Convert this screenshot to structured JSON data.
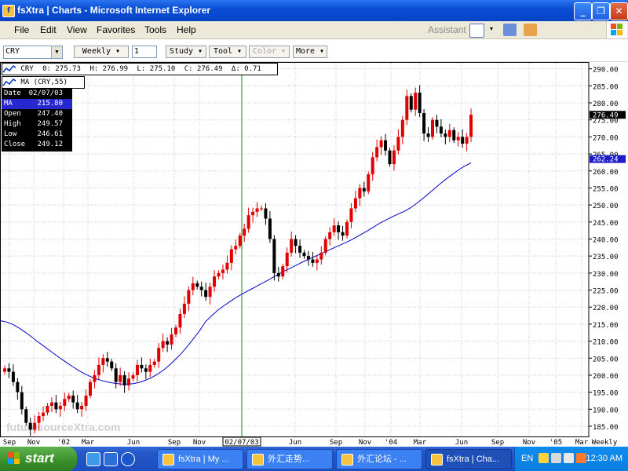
{
  "window": {
    "title": "fsXtra | Charts - Microsoft Internet Explorer",
    "app_icon": "fs-icon",
    "controls": [
      "minimize-icon",
      "maximize-icon",
      "close-icon"
    ]
  },
  "menubar": {
    "items": [
      "File",
      "Edit",
      "View",
      "Favorites",
      "Tools",
      "Help"
    ],
    "assistant": "Assistant"
  },
  "toolbar": {
    "symbol": "CRY",
    "period": "Weekly ▾",
    "count": "1",
    "study": "Study ▾",
    "tool": "Tool ▾",
    "color": "Color ▾",
    "more": "More ▾"
  },
  "chart_data": {
    "type": "candlestick",
    "symbol": "CRY",
    "ohlc_header": {
      "open": "0: 275.73",
      "high": "H: 276.99",
      "low": "L: 275.10",
      "close": "C: 276.49",
      "change": "Δ: 0.71"
    },
    "study_label": "MA (CRY,55)",
    "info_box": [
      {
        "label": "Date",
        "value": "02/07/03"
      },
      {
        "label": "MA",
        "value": "215.80"
      },
      {
        "label": "Open",
        "value": "247.40"
      },
      {
        "label": "High",
        "value": "249.57"
      },
      {
        "label": "Low",
        "value": "246.61"
      },
      {
        "label": "Close",
        "value": "249.12"
      }
    ],
    "y_ticks": [
      "290.00",
      "285.00",
      "280.00",
      "275.00",
      "270.00",
      "265.00",
      "260.00",
      "255.00",
      "250.00",
      "245.00",
      "240.00",
      "235.00",
      "230.00",
      "225.00",
      "220.00",
      "215.00",
      "210.00",
      "205.00",
      "200.00",
      "195.00",
      "190.00",
      "185.00"
    ],
    "ylim": [
      182,
      292
    ],
    "x_labels": [
      "Sep",
      "Nov",
      "'02",
      "Mar",
      "Jun",
      "Sep",
      "Nov",
      "02/07/03",
      "Jun",
      "Sep",
      "Nov",
      "'04",
      "Mar",
      "Jun",
      "Sep",
      "Nov",
      "'05",
      "Mar",
      "Weekly"
    ],
    "last_price_label": "276.49",
    "ma_price_label": "262.24",
    "watermark": "futuresourceXtra.com",
    "colors": {
      "up": "#e00000",
      "down": "#000000",
      "ma": "#0000cc",
      "crosshair": "#009900",
      "grid": "#c8c8c8"
    },
    "close_series": [
      202,
      201,
      198,
      195,
      190,
      186,
      184,
      186,
      188,
      189,
      191,
      192,
      190,
      191,
      193,
      194,
      192,
      190,
      191,
      194,
      198,
      200,
      203,
      205,
      204,
      202,
      198,
      200,
      197,
      199,
      200,
      203,
      202,
      201,
      203,
      204,
      208,
      210,
      209,
      212,
      214,
      218,
      221,
      225,
      227,
      226,
      225,
      223,
      226,
      229,
      230,
      231,
      233,
      237,
      238,
      241,
      243,
      247,
      248,
      249,
      249,
      246,
      240,
      230,
      229,
      232,
      236,
      240,
      238,
      236,
      235,
      234,
      233,
      234,
      236,
      240,
      242,
      244,
      242,
      241,
      245,
      249,
      252,
      255,
      254,
      259,
      264,
      267,
      269,
      266,
      262,
      266,
      270,
      275,
      282,
      278,
      283,
      277,
      271,
      270,
      275,
      273,
      271,
      270,
      272,
      269,
      270,
      268,
      270,
      276.5
    ],
    "ma_series": [
      216,
      215.6,
      214.9,
      213.9,
      212.7,
      211.4,
      210,
      208.7,
      207.4,
      206.1,
      204.8,
      203.6,
      202.4,
      201.3,
      200.3,
      199.5,
      198.8,
      198.3,
      197.9,
      197.6,
      197.4,
      197.4,
      197.5,
      197.9,
      198.5,
      199.3,
      200.3,
      201.5,
      203,
      204.7,
      206.5,
      208.6,
      210.8,
      213.1,
      215.8,
      217.5,
      219.1,
      220.4,
      221.6,
      222.8,
      223.8,
      224.8,
      225.7,
      226.7,
      227.6,
      228.6,
      229.6,
      230.6,
      231.4,
      232.3,
      233.2,
      234,
      234.8,
      235.6,
      236.4,
      237.2,
      238,
      238.8,
      239.6,
      240.6,
      241.6,
      242.6,
      243.7,
      244.8,
      245.7,
      246.6,
      247.4,
      248.2,
      249.2,
      250.5,
      251.9,
      253.4,
      254.9,
      256.4,
      257.8,
      259.1,
      260.4,
      261.5,
      262.4
    ]
  },
  "taskbar": {
    "start": "start",
    "tasks": [
      "fsXtra | My ...",
      "外汇走势...",
      "外汇论坛 - ...",
      "fsXtra | Cha..."
    ],
    "lang": "EN",
    "clock": "12:30 AM"
  }
}
